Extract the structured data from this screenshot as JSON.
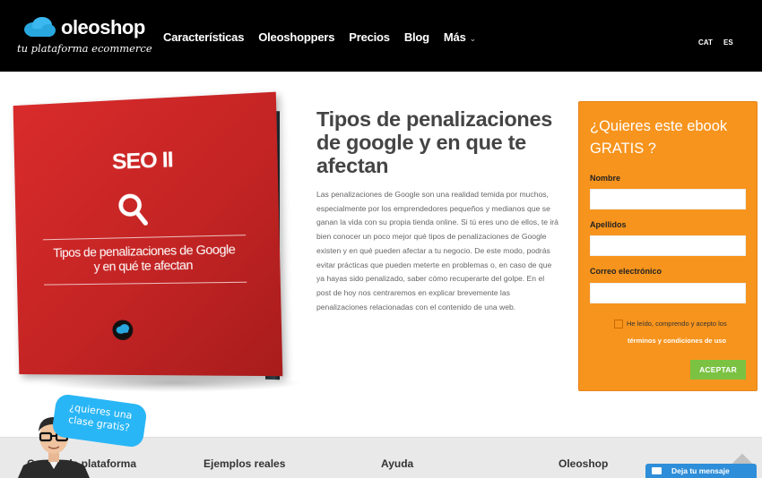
{
  "header": {
    "brand": "oleoshop",
    "tagline": "tu plataforma ecommerce",
    "nav": [
      "Características",
      "Oleoshoppers",
      "Precios",
      "Blog",
      "Más"
    ],
    "languages": [
      "CAT",
      "ES"
    ]
  },
  "book": {
    "title": "SEO II",
    "subtitle_line1": "Tipos de penalizaciones de Google",
    "subtitle_line2": "y en qué te afectan",
    "badge": "oleoshop"
  },
  "article": {
    "title": "Tipos de penalizaciones de google y en que te afectan",
    "body": "Las penalizaciones de Google son una realidad temida por muchos, especialmente por los emprendedores pequeños y medianos que se ganan la vida con su propia tienda online. Si tú eres uno de ellos, te irá bien conocer un poco mejor qué tipos de penalizaciones de Google existen y en qué pueden afectar a tu negocio. De este modo, podrás evitar prácticas que pueden meterte en problemas o, en caso de que ya hayas sido penalizado, saber cómo recuperarte del golpe. En el post de hoy nos centraremos en explicar brevemente las penalizaciones relacionadas con el contenido de una web."
  },
  "form": {
    "title": "¿Quieres este ebook GRATIS ?",
    "fields": [
      {
        "label": "Nombre",
        "value": ""
      },
      {
        "label": "Apellidos",
        "value": ""
      },
      {
        "label": "Correo electrónico",
        "value": ""
      }
    ],
    "terms_text": "He leído, comprendo y acepto los",
    "terms_link": "términos y condiciones de uso",
    "submit": "ACEPTAR"
  },
  "bubble": {
    "line1": "¿quieres una",
    "line2": "clase gratis?"
  },
  "footer": {
    "columns": [
      "Conoce la plataforma",
      "Ejemplos reales",
      "Ayuda",
      "Oleoshop"
    ]
  },
  "chat": {
    "label": "Deja tu mensaje"
  },
  "colors": {
    "header_bg": "#000000",
    "book_red": "#c42424",
    "form_orange": "#f7941d",
    "button_green": "#7bc242",
    "chat_blue": "#2f8ed9",
    "bubble_blue": "#29b6f6"
  }
}
